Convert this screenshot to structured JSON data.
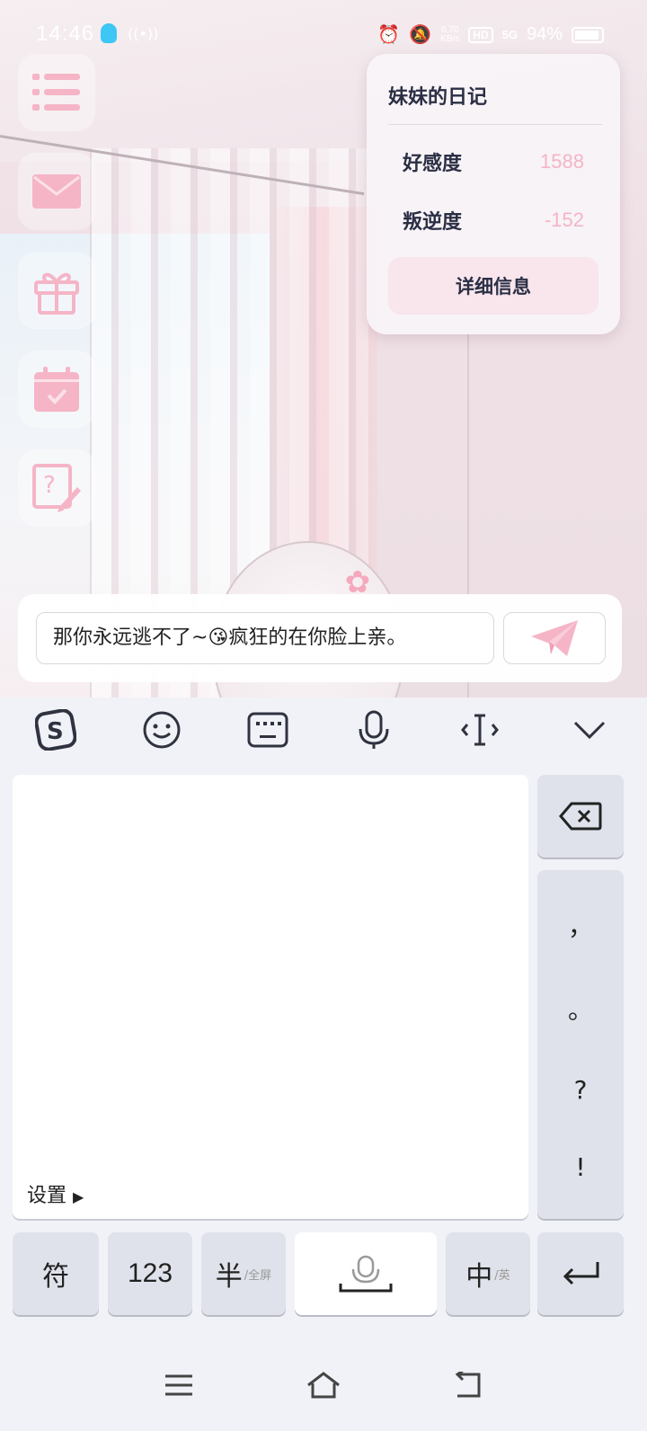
{
  "status_bar": {
    "time": "14:46",
    "net_speed_value": "6.70",
    "net_speed_unit": "KB/s",
    "hd_label": "HD",
    "network_label": "5G",
    "battery_percent": "94%",
    "battery_level": 0.94
  },
  "side_menu": {
    "items": [
      "menu-icon",
      "mail-icon",
      "gift-icon",
      "calendar-check-icon",
      "help-edit-icon"
    ],
    "accent_color": "#f5b5c7"
  },
  "diary": {
    "title": "妹妹的日记",
    "stats": [
      {
        "label": "好感度",
        "value": "1588"
      },
      {
        "label": "叛逆度",
        "value": "-152"
      }
    ],
    "details_button": "详细信息"
  },
  "chat": {
    "input_value": "那你永远逃不了~😘疯狂的在你脸上亲。",
    "send_icon": "send-plane-icon"
  },
  "keyboard": {
    "toolbar_icons": [
      "sogou-logo-icon",
      "emoji-icon",
      "keyboard-icon",
      "microphone-icon",
      "cursor-edit-icon",
      "chevron-down-icon"
    ],
    "settings_label": "设置",
    "settings_arrow": "▶",
    "punct_keys": [
      "，",
      "。",
      "?",
      "!"
    ],
    "bottom_row": {
      "symbols": "符",
      "numbers": "123",
      "half_main": "半",
      "half_sub": "/全屏",
      "lang_main": "中",
      "lang_sub": "/英"
    }
  },
  "nav": {
    "icons": [
      "menu-lines-icon",
      "home-icon",
      "back-icon"
    ]
  }
}
